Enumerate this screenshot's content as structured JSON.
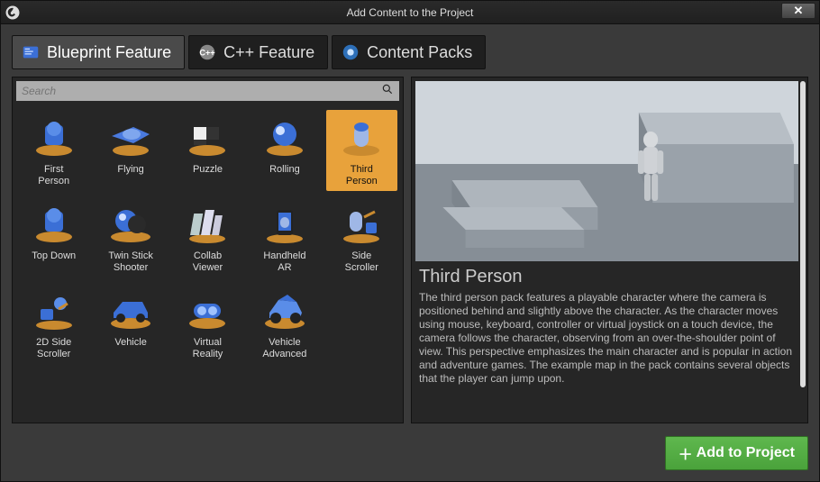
{
  "window": {
    "title": "Add Content to the Project"
  },
  "tabs": [
    {
      "id": "blueprint",
      "label": "Blueprint Feature",
      "selected": true
    },
    {
      "id": "cpp",
      "label": "C++ Feature",
      "selected": false
    },
    {
      "id": "packs",
      "label": "Content Packs",
      "selected": false
    }
  ],
  "search": {
    "placeholder": "Search"
  },
  "templates": [
    {
      "id": "first-person",
      "label": "First\nPerson"
    },
    {
      "id": "flying",
      "label": "Flying"
    },
    {
      "id": "puzzle",
      "label": "Puzzle"
    },
    {
      "id": "rolling",
      "label": "Rolling"
    },
    {
      "id": "third-person",
      "label": "Third\nPerson",
      "selected": true
    },
    {
      "id": "top-down",
      "label": "Top Down"
    },
    {
      "id": "twin-stick",
      "label": "Twin Stick\nShooter"
    },
    {
      "id": "collab",
      "label": "Collab\nViewer"
    },
    {
      "id": "handheld-ar",
      "label": "Handheld\nAR"
    },
    {
      "id": "side-scroller",
      "label": "Side\nScroller"
    },
    {
      "id": "2d-side",
      "label": "2D Side\nScroller"
    },
    {
      "id": "vehicle",
      "label": "Vehicle"
    },
    {
      "id": "vr",
      "label": "Virtual\nReality"
    },
    {
      "id": "vehicle-adv",
      "label": "Vehicle\nAdvanced"
    }
  ],
  "detail": {
    "title": "Third Person",
    "description": "The third person pack features a playable character where the camera is positioned behind and slightly above the character. As the character moves using mouse, keyboard, controller or virtual joystick on a touch device, the camera follows the character, observing from an over-the-shoulder point of view. This perspective emphasizes the main character and is popular in action and adventure games. The example map in the pack contains several objects that the player can jump upon."
  },
  "footer": {
    "add_label": "Add to Project"
  }
}
